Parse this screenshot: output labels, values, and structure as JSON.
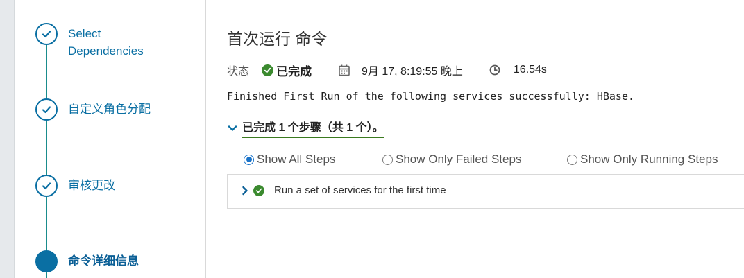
{
  "wizard": {
    "steps": [
      {
        "label_line1": "Select",
        "label_line2": "Dependencies",
        "state": "completed"
      },
      {
        "label": "自定义角色分配",
        "state": "completed"
      },
      {
        "label": "审核更改",
        "state": "completed"
      },
      {
        "label": "命令详细信息",
        "state": "current"
      }
    ]
  },
  "main": {
    "title": "首次运行 命令",
    "status_label": "状态",
    "status_value": "已完成",
    "date": "9月 17, 8:19:55 晚上",
    "duration": "16.54s",
    "message": "Finished First Run of the following services successfully: HBase.",
    "steps_summary": "已完成 1 个步骤（共 1 个）。",
    "filters": {
      "all": "Show All Steps",
      "failed": "Show Only Failed Steps",
      "running": "Show Only Running Steps",
      "selected": "all"
    },
    "step_items": [
      {
        "name": "Run a set of services for the first time",
        "status": "success"
      }
    ]
  },
  "colors": {
    "accent": "#0a6fa3",
    "success": "#3b8a2f",
    "radio_selected": "#1a73c9"
  }
}
